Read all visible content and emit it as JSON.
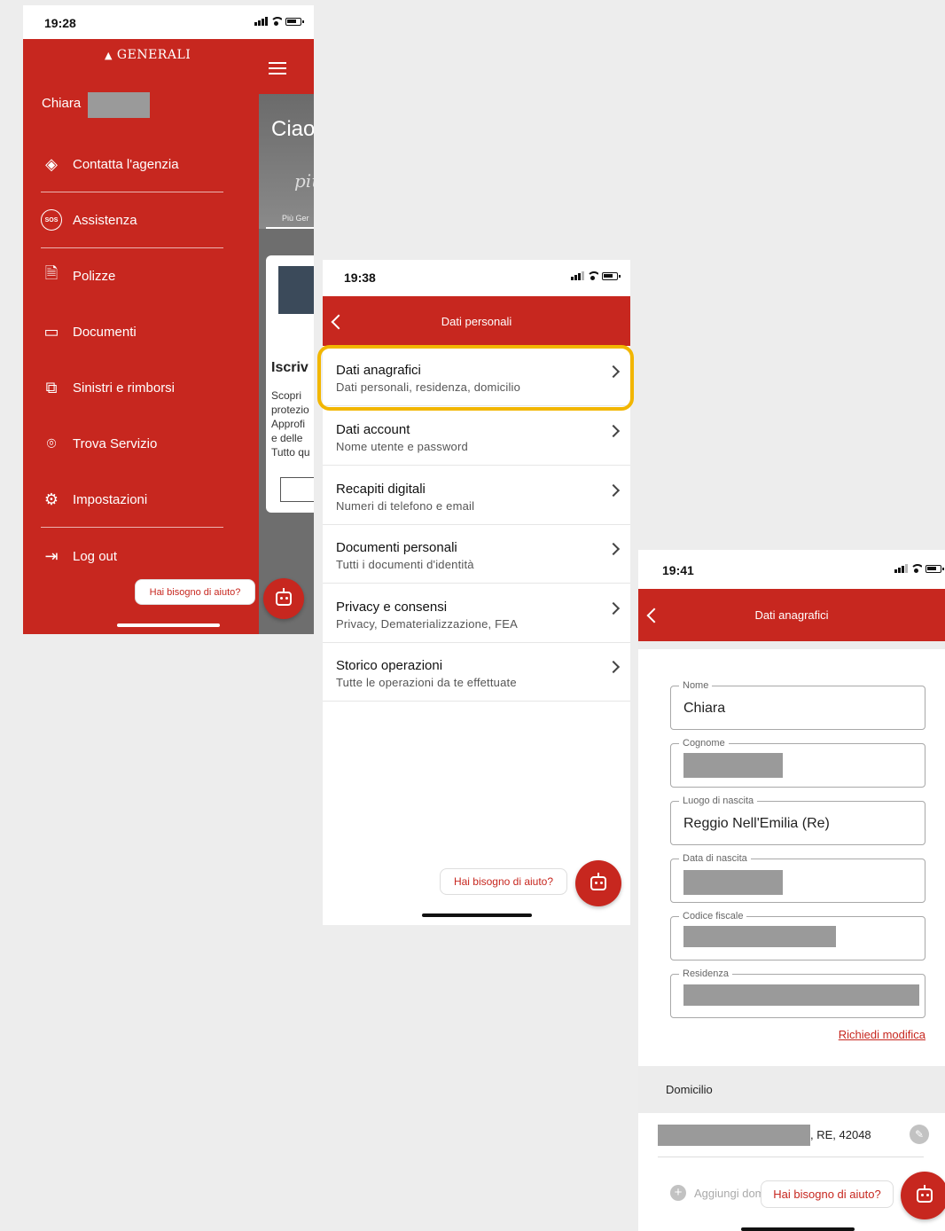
{
  "screen1": {
    "status_time": "19:28",
    "brand": "GENERALI",
    "user_first_name": "Chiara",
    "menu": [
      {
        "label": "Contatta l'agenzia",
        "icon": "location-chat-icon"
      },
      {
        "label": "Assistenza",
        "icon": "sos-icon",
        "icon_text": "SOS"
      },
      {
        "label": "Polizze",
        "icon": "policy-document-icon"
      },
      {
        "label": "Documenti",
        "icon": "folder-icon"
      },
      {
        "label": "Sinistri e rimborsi",
        "icon": "claims-documents-icon"
      },
      {
        "label": "Trova Servizio",
        "icon": "map-pin-icon"
      },
      {
        "label": "Impostazioni",
        "icon": "gear-icon"
      },
      {
        "label": "Log out",
        "icon": "logout-icon"
      }
    ],
    "bg_app": {
      "greeting_fragment": "Ciao",
      "script_fragment": "più",
      "tab_fragment": "Più Ger",
      "card_title_fragment": "Iscriv",
      "card_lines": [
        "Scopri",
        "protezio",
        "Approfi",
        "e delle",
        "Tutto qu"
      ]
    },
    "help_label": "Hai bisogno di aiuto?"
  },
  "screen2": {
    "status_time": "19:38",
    "header_title": "Dati personali",
    "rows": [
      {
        "title": "Dati anagrafici",
        "subtitle": "Dati personali, residenza, domicilio"
      },
      {
        "title": "Dati account",
        "subtitle": "Nome utente e password"
      },
      {
        "title": "Recapiti digitali",
        "subtitle": "Numeri di telefono e email"
      },
      {
        "title": "Documenti personali",
        "subtitle": "Tutti i documenti d'identità"
      },
      {
        "title": "Privacy e consensi",
        "subtitle": "Privacy, Dematerializzazione, FEA"
      },
      {
        "title": "Storico operazioni",
        "subtitle": "Tutte le operazioni da te effettuate"
      }
    ],
    "help_label": "Hai bisogno di aiuto?"
  },
  "screen3": {
    "status_time": "19:41",
    "header_title": "Dati anagrafici",
    "fields": [
      {
        "label": "Nome",
        "value": "Chiara"
      },
      {
        "label": "Cognome",
        "value": ""
      },
      {
        "label": "Luogo di nascita",
        "value": "Reggio Nell'Emilia (Re)"
      },
      {
        "label": "Data di nascita",
        "value": ""
      },
      {
        "label": "Codice fiscale",
        "value": ""
      },
      {
        "label": "Residenza",
        "value": ""
      }
    ],
    "request_change": "Richiedi modifica",
    "domicilio_title": "Domicilio",
    "domicilio_value_suffix": ", RE, 42048",
    "add_label_fragment": "Aggiungi dom",
    "help_label": "Hai bisogno di aiuto?",
    "colors": {
      "brand_red": "#c7271f",
      "highlight": "#f2b600"
    }
  }
}
